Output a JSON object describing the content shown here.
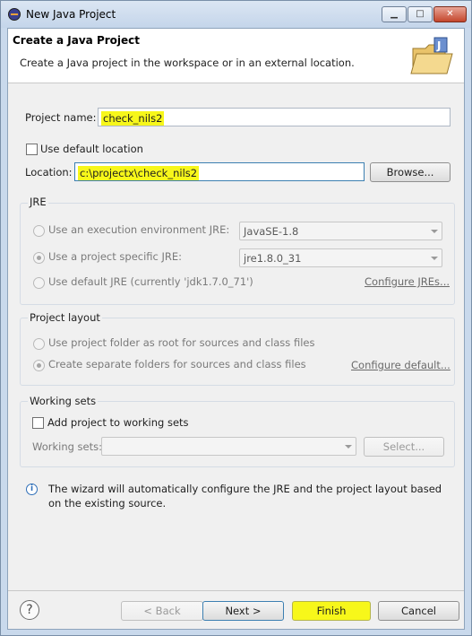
{
  "window": {
    "title": "New Java Project",
    "minimize": "▁",
    "maximize": "□",
    "close": "✕"
  },
  "banner": {
    "heading": "Create a Java Project",
    "description": "Create a Java project in the workspace or in an external location.",
    "icon": "java-project-folder-icon"
  },
  "project": {
    "label": "Project name:",
    "value": "check_nils2"
  },
  "location": {
    "use_default_label": "Use default location",
    "use_default_checked": false,
    "label": "Location:",
    "value": "c:\\projectx\\check_nils2",
    "browse_label": "Browse..."
  },
  "jre": {
    "title": "JRE",
    "option_env": "Use an execution environment JRE:",
    "env_value": "JavaSE-1.8",
    "option_specific": "Use a project specific JRE:",
    "specific_value": "jre1.8.0_31",
    "option_default": "Use default JRE (currently 'jdk1.7.0_71')",
    "configure_link": "Configure JREs..."
  },
  "layout": {
    "title": "Project layout",
    "option_root": "Use project folder as root for sources and class files",
    "option_separate": "Create separate folders for sources and class files",
    "configure_link": "Configure default..."
  },
  "working_sets": {
    "title": "Working sets",
    "add_label": "Add project to working sets",
    "sets_label": "Working sets:",
    "select_label": "Select..."
  },
  "info": "The wizard will automatically configure the JRE and the project layout based on the existing source.",
  "footer": {
    "help": "?",
    "back": "< Back",
    "next": "Next >",
    "finish": "Finish",
    "cancel": "Cancel"
  },
  "colors": {
    "highlight": "#f7f71a",
    "accent": "#3c7fb1"
  }
}
